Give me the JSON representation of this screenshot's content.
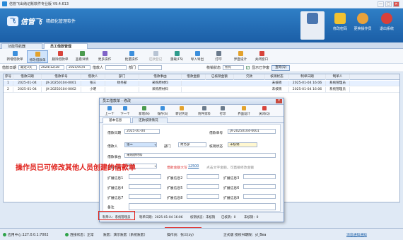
{
  "window": {
    "title": "信管飞出纳记账软件专业版 V9.4.613",
    "controls": [
      "—",
      "□",
      "✕"
    ]
  },
  "header": {
    "logo_mark": "飞",
    "logo_text": "信管飞",
    "logo_sub": "精细化管理软件",
    "home_label": "",
    "buttons": [
      {
        "label": "修改密码",
        "icon": "lock-icon"
      },
      {
        "label": "更换操作员",
        "icon": "user-switch-icon"
      },
      {
        "label": "退出系统",
        "icon": "exit-icon"
      }
    ]
  },
  "tabs": [
    {
      "label": "功能导航器"
    },
    {
      "label": "员工借款管理"
    }
  ],
  "toolbar": [
    {
      "label": "新增借款单",
      "icon": "add-doc-icon"
    },
    {
      "label": "修改借款单",
      "icon": "edit-doc-icon"
    },
    {
      "label": "删除借款单",
      "icon": "delete-doc-icon"
    },
    {
      "label": "查看详情",
      "icon": "view-icon"
    },
    {
      "label": "更多操作",
      "icon": "more-icon"
    },
    {
      "label": "批量操作",
      "icon": "batch-icon"
    },
    {
      "label": "还款登记",
      "icon": "repay-icon"
    },
    {
      "label": "重载(F5)",
      "icon": "reload-icon"
    },
    {
      "label": "导入导出",
      "icon": "import-export-icon"
    },
    {
      "label": "打印",
      "icon": "print-icon"
    },
    {
      "label": "界面设计",
      "icon": "design-icon"
    },
    {
      "label": "关闭窗口",
      "icon": "close-window-icon"
    }
  ],
  "filter": {
    "date_label": "借款日期",
    "date_range": "最近3天",
    "date_from": "2024/12/28",
    "date_to": "2025/01/4",
    "person_label": "借款人",
    "dept_label": "部门",
    "status_label": "核销状态",
    "status_value": "所有",
    "show_closed_label": "显示已作废",
    "show_closed_mark": "✓",
    "query_button": "查询(Q)"
  },
  "grid": {
    "columns": [
      "序号",
      "借款日期",
      "借款单号",
      "借款人",
      "部门",
      "借款事由",
      "借款金额",
      "已核销金额",
      "欠款",
      "核销状态",
      "制单日期",
      "制单人"
    ],
    "rows": [
      {
        "no": "1",
        "date": "2025-01-04",
        "code": "JX-20250104-0001",
        "person": "张三",
        "dept": "财务部",
        "reason": "采购原材料",
        "status": "未核销",
        "created": "2025-01-04 16:06",
        "creator": "系统管理员"
      },
      {
        "no": "2",
        "date": "2025-01-04",
        "code": "JX-20250104-0002",
        "person": "小明",
        "dept": "",
        "reason": "采购原材料",
        "status": "未核销",
        "created": "2025-01-04 16:06",
        "creator": "系统管理员"
      }
    ]
  },
  "dialog": {
    "title": "员工借款单 - 修改",
    "close": "✕",
    "toolbar": [
      {
        "label": "上一个",
        "icon": "prev-icon"
      },
      {
        "label": "下一个",
        "icon": "next-icon"
      },
      {
        "label": "新增(N)",
        "icon": "add-icon"
      },
      {
        "label": "保存(S)",
        "icon": "save-icon"
      },
      {
        "label": "转记凭证",
        "icon": "voucher-icon"
      },
      {
        "label": "附件资料",
        "icon": "attachment-icon"
      },
      {
        "label": "打印",
        "icon": "print-icon"
      },
      {
        "label": "界面设计",
        "icon": "design-icon"
      },
      {
        "label": "关闭(Q)",
        "icon": "close-icon"
      }
    ],
    "tabs": [
      "基本信息",
      "还款核销情况"
    ],
    "form": {
      "date_label": "借款日期",
      "date_value": "2025-01-04",
      "code_label": "借款单号",
      "code_value": "JX-20250104-0001",
      "person_label": "借款人",
      "person_value": "张三",
      "dept_label": "部门",
      "dept_value": "财务部",
      "status_label": "核销状态",
      "status_value": "未核销",
      "reason_label": "借款事由",
      "reason_value": "采购原材料",
      "amount_label": "借款金额",
      "amount_value": "5600",
      "words_label": "借款金额大写",
      "words_value": "零仟元整",
      "settle_amount": "12500",
      "hint": "点击文字金额，可直接修改金额",
      "ext1_label": "扩展信息1",
      "ext2_label": "扩展信息2",
      "ext3_label": "扩展信息3",
      "ext4_label": "扩展信息4",
      "ext5_label": "扩展信息5",
      "ext6_label": "扩展信息6",
      "ext7_label": "扩展信息7",
      "ext8_label": "扩展信息8",
      "ext9_label": "扩展信息9",
      "note_label": "备注"
    },
    "status": {
      "creator": "制单人：系统管理员",
      "created": "制单日期：2025-01-04 16:06",
      "verify": "核销状态：未核销",
      "settled": "已核销：0",
      "balance": "未核销：0"
    }
  },
  "annotation": "操作员已可修改其他人员创建的借款单",
  "statusbar": {
    "app_server": "应用中心:127.0.0.1:7002",
    "conn": "连接状态：正常",
    "book": "账套：演示账套（系统账套）",
    "operator": "操作员：张三(zy)",
    "edition": "正式版 授权书期限：yl_Bea",
    "link": "消息通知通知"
  },
  "colors": {
    "header": "#1b5ea6",
    "accent": "#2f7fc6",
    "annotation": "#e0201a"
  }
}
